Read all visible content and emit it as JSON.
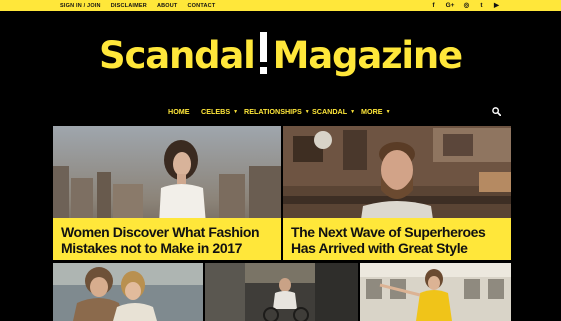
{
  "topbar": {
    "links": [
      "SIGN IN / JOIN",
      "DISCLAIMER",
      "ABOUT",
      "CONTACT"
    ],
    "social_icons": [
      "facebook-icon",
      "google-plus-icon",
      "instagram-icon",
      "twitter-icon",
      "youtube-icon"
    ],
    "social_glyphs": [
      "f",
      "G+",
      "◎",
      "t",
      "▶"
    ]
  },
  "logo": {
    "part1": "Scandal",
    "part2": "Magazine"
  },
  "nav": {
    "items": [
      {
        "label": "HOME",
        "dropdown": false
      },
      {
        "label": "CELEBS",
        "dropdown": true
      },
      {
        "label": "RELATIONSHIPS",
        "dropdown": true
      },
      {
        "label": "SCANDAL",
        "dropdown": true
      },
      {
        "label": "MORE",
        "dropdown": true
      }
    ]
  },
  "features": [
    {
      "title_line1": "Women Discover What Fashion",
      "title_line2": "Mistakes not to Make in 2017"
    },
    {
      "title_line1": "The Next Wave of Superheroes",
      "title_line2": "Has Arrived with Great Style"
    }
  ],
  "colors": {
    "accent": "#ffe73a",
    "background": "#000000",
    "text_dark": "#111111"
  }
}
